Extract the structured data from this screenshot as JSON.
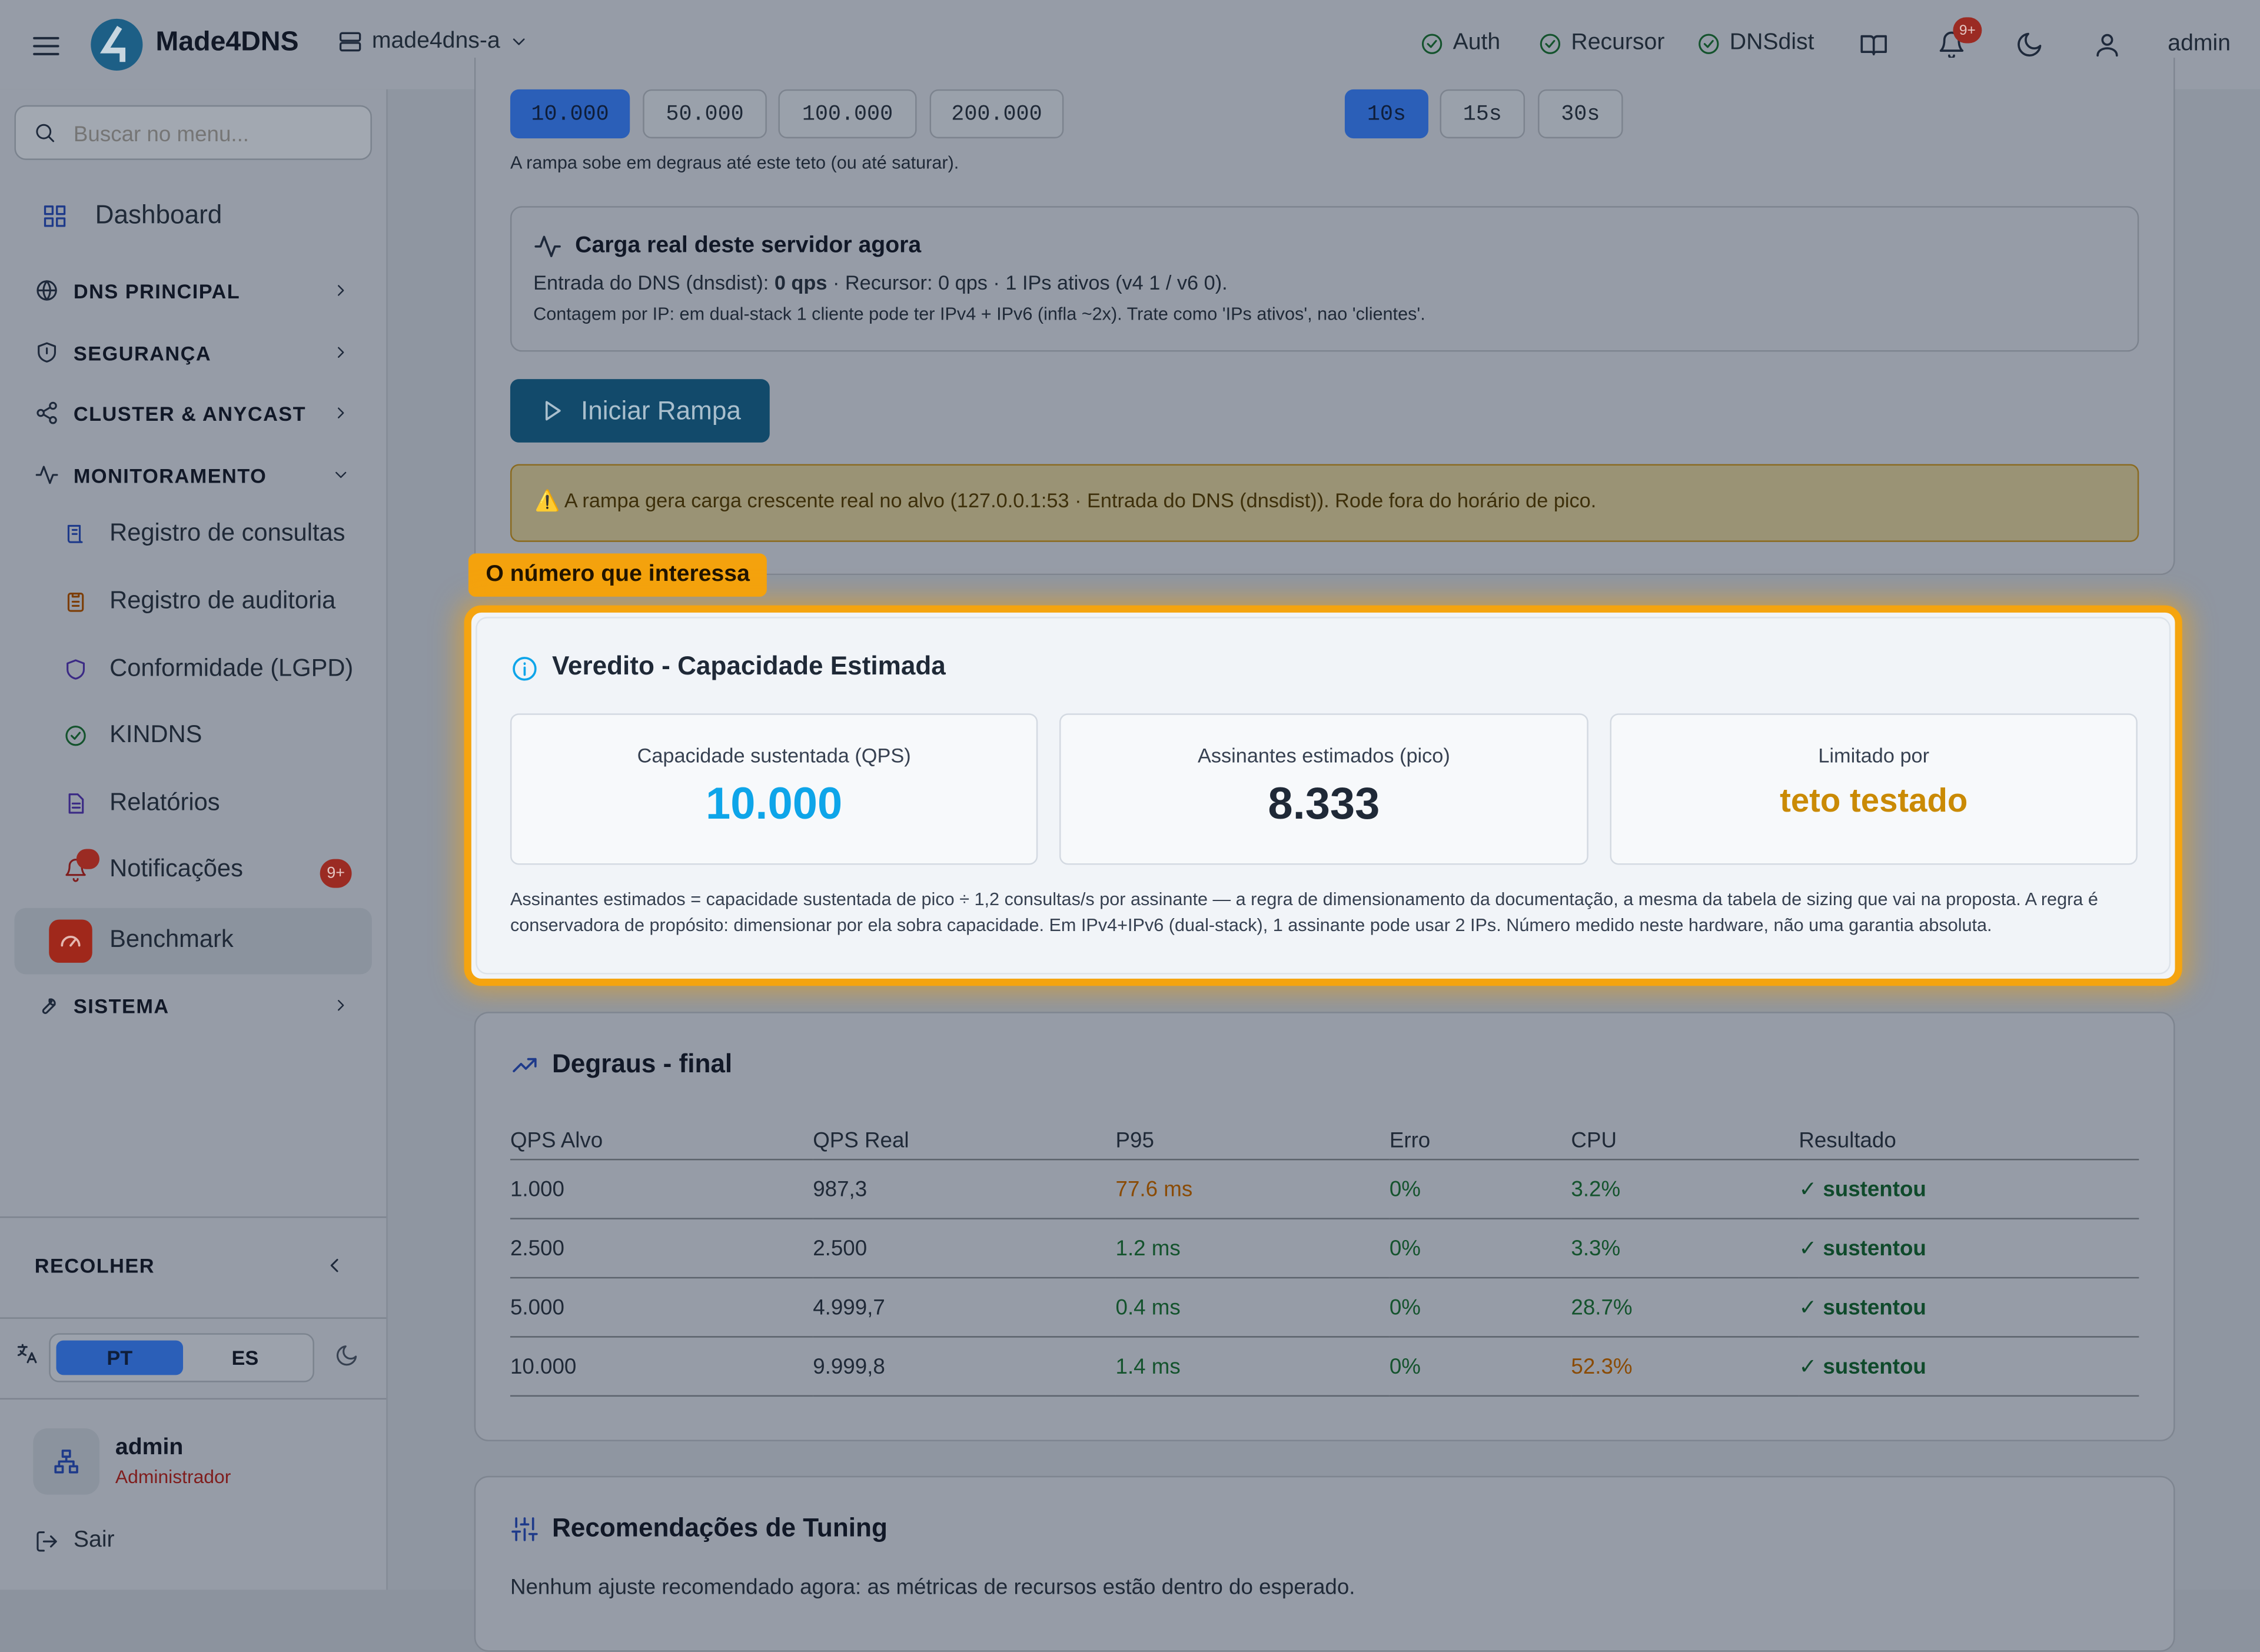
{
  "topbar": {
    "brand": "Made4DNS",
    "server": "made4dns-a",
    "status": [
      "Auth",
      "Recursor",
      "DNSdist"
    ],
    "notif_badge": "9+",
    "user": "admin"
  },
  "sidebar": {
    "search_placeholder": "Buscar no menu...",
    "dashboard": "Dashboard",
    "groups": [
      "DNS PRINCIPAL",
      "SEGURANÇA",
      "CLUSTER & ANYCAST",
      "MONITORAMENTO"
    ],
    "monitor_items": [
      "Registro de consultas",
      "Registro de auditoria",
      "Conformidade (LGPD)",
      "KINDNS",
      "Relatórios",
      "Notificações",
      "Benchmark"
    ],
    "notif_badge": "9+",
    "sistema": "SISTEMA",
    "collapse": "RECOLHER",
    "lang": [
      "PT",
      "ES"
    ],
    "user_name": "admin",
    "user_role": "Administrador",
    "logout": "Sair"
  },
  "controls": {
    "qps_options": [
      "10.000",
      "50.000",
      "100.000",
      "200.000"
    ],
    "time_options": [
      "10s",
      "15s",
      "30s"
    ],
    "ramp_hint": "A rampa sobe em degraus até este teto (ou até saturar)."
  },
  "live": {
    "title": "Carga real deste servidor agora",
    "line1_a": "Entrada do DNS (dnsdist): ",
    "line1_b": "0 qps",
    "line1_c": " · Recursor: 0 qps · 1 IPs ativos (v4 1 / v6 0).",
    "line2": "Contagem por IP: em dual-stack 1 cliente pode ter IPv4 + IPv6 (infla ~2x). Trate como 'IPs ativos', nao 'clientes'."
  },
  "start_button": "Iniciar Rampa",
  "warning": "⚠️ A rampa gera carga crescente real no alvo (127.0.0.1:53 · Entrada do DNS (dnsdist)). Rode fora do horário de pico.",
  "highlight_tag": "O número que interessa",
  "verdict": {
    "title": "Veredito - Capacidade Estimada",
    "stats": [
      {
        "label": "Capacidade sustentada (QPS)",
        "value": "10.000"
      },
      {
        "label": "Assinantes estimados (pico)",
        "value": "8.333"
      },
      {
        "label": "Limitado por",
        "value": "teto testado"
      }
    ],
    "note": "Assinantes estimados = capacidade sustentada de pico ÷ 1,2 consultas/s por assinante — a regra de dimensionamento da documentação, a mesma da tabela de sizing que vai na proposta. A regra é conservadora de propósito: dimensionar por ela sobra capacidade. Em IPv4+IPv6 (dual-stack), 1 assinante pode usar 2 IPs. Número medido neste hardware, não uma garantia absoluta."
  },
  "steps": {
    "title": "Degraus - final",
    "columns": [
      "QPS Alvo",
      "QPS Real",
      "P95",
      "Erro",
      "CPU",
      "Resultado"
    ],
    "rows": [
      [
        "1.000",
        "987,3",
        "77.6 ms",
        "0%",
        "3.2%",
        "✓ sustentou"
      ],
      [
        "2.500",
        "2.500",
        "1.2 ms",
        "0%",
        "3.3%",
        "✓ sustentou"
      ],
      [
        "5.000",
        "4.999,7",
        "0.4 ms",
        "0%",
        "28.7%",
        "✓ sustentou"
      ],
      [
        "10.000",
        "9.999,8",
        "1.4 ms",
        "0%",
        "52.3%",
        "✓ sustentou"
      ]
    ]
  },
  "tuning": {
    "title": "Recomendações de Tuning",
    "text": "Nenhum ajuste recomendado agora: as métricas de recursos estão dentro do esperado."
  }
}
